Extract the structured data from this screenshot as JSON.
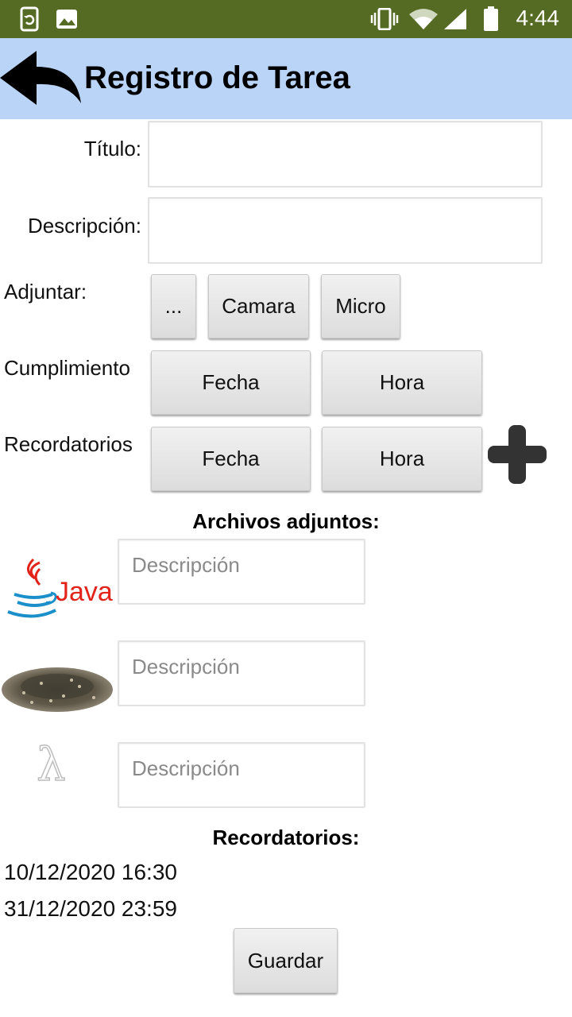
{
  "status_bar": {
    "time": "4:44",
    "icons": [
      "screen-rotation-icon",
      "image-icon",
      "vibrate-icon",
      "wifi-icon",
      "signal-icon",
      "battery-icon"
    ]
  },
  "app_bar": {
    "title": "Registro de Tarea",
    "back_icon": "back-arrow-icon",
    "color": "#b9d4f6"
  },
  "form": {
    "titulo_label": "Título:",
    "titulo_value": "",
    "descripcion_label": "Descripción:",
    "descripcion_value": "",
    "adjuntar_label": "Adjuntar:",
    "adjuntar_buttons": [
      "...",
      "Camara",
      "Micro"
    ],
    "cumplimiento_label": "Cumplimiento",
    "cumplimiento_fecha": "Fecha",
    "cumplimiento_hora": "Hora",
    "recordatorios_label": "Recordatorios",
    "recordatorios_fecha": "Fecha",
    "recordatorios_hora": "Hora",
    "add_icon": "plus-icon"
  },
  "attachments": {
    "title": "Archivos adjuntos:",
    "items": [
      {
        "thumb": "java-logo",
        "logo_text": "Java",
        "placeholder": "Descripción"
      },
      {
        "thumb": "seeds-image",
        "placeholder": "Descripción"
      },
      {
        "thumb": "lambda-icon",
        "glyph": "λ",
        "placeholder": "Descripción"
      }
    ]
  },
  "reminders": {
    "title": "Recordatorios:",
    "items": [
      "10/12/2020 16:30",
      "31/12/2020 23:59"
    ]
  },
  "save_label": "Guardar",
  "colors": {
    "status_bar": "#556b24",
    "accent": "#b9d4f6"
  }
}
